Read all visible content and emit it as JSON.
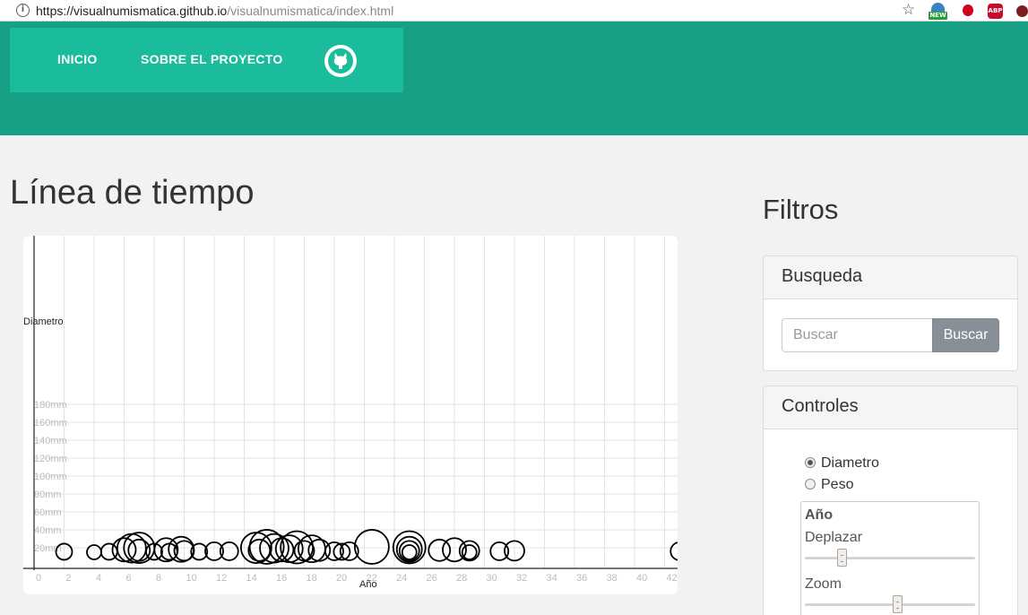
{
  "browser": {
    "url_host": "https://visualnumismatica.github.io",
    "url_path": "/visualnumismatica/index.html",
    "extensions": [
      "new-globe-icon",
      "bug-icon",
      "abp-icon",
      "extension-icon"
    ],
    "new_badge": "NEW",
    "abp_label": "ABP"
  },
  "nav": {
    "inicio": "INICIO",
    "sobre": "SOBRE EL PROYECTO"
  },
  "main": {
    "title": "Línea de tiempo"
  },
  "filters": {
    "title": "Filtros",
    "search": {
      "heading": "Busqueda",
      "placeholder": "Buscar",
      "button": "Buscar"
    },
    "controls": {
      "heading": "Controles",
      "options": [
        {
          "label": "Diametro",
          "checked": true
        },
        {
          "label": "Peso",
          "checked": false
        }
      ],
      "year": {
        "title": "Año",
        "pan_label": "Deplazar",
        "zoom_label": "Zoom",
        "pan_level": 0.2,
        "zoom_level": 0.55
      }
    }
  },
  "colors": {
    "header": "#18a085",
    "nav_box": "#1abc9c",
    "page_bg": "#f2f2f2",
    "button_gray": "#888f97"
  },
  "chart_data": {
    "type": "scatter",
    "xlabel": "Año",
    "ylabel": "Diametro",
    "x_ticks": [
      "0",
      "2",
      "4",
      "6",
      "8",
      "10",
      "12",
      "14",
      "16",
      "18",
      "20",
      "22",
      "24",
      "26",
      "28",
      "30",
      "32",
      "34",
      "36",
      "38",
      "40",
      "42"
    ],
    "y_ticks": [
      "20mm",
      "40mm",
      "60mm",
      "80mm",
      "100mm",
      "120mm",
      "140mm",
      "160mm",
      "180mm"
    ],
    "xlim": [
      0,
      43
    ],
    "ylim": [
      0,
      180
    ],
    "grid": true,
    "marker": "hollow-circle",
    "note_size": "circle size encodes diameter",
    "points": [
      {
        "x": 2,
        "d": 18
      },
      {
        "x": 4,
        "d": 16
      },
      {
        "x": 5,
        "d": 18
      },
      {
        "x": 6,
        "d": 26
      },
      {
        "x": 6.5,
        "d": 32
      },
      {
        "x": 7,
        "d": 34
      },
      {
        "x": 7,
        "d": 24
      },
      {
        "x": 8,
        "d": 18
      },
      {
        "x": 8.8,
        "d": 26
      },
      {
        "x": 9,
        "d": 18
      },
      {
        "x": 9.8,
        "d": 28
      },
      {
        "x": 10,
        "d": 22
      },
      {
        "x": 11,
        "d": 18
      },
      {
        "x": 12,
        "d": 20
      },
      {
        "x": 13,
        "d": 20
      },
      {
        "x": 14.8,
        "d": 34
      },
      {
        "x": 15,
        "d": 24
      },
      {
        "x": 15.5,
        "d": 38
      },
      {
        "x": 16,
        "d": 32
      },
      {
        "x": 16.5,
        "d": 26
      },
      {
        "x": 17,
        "d": 30
      },
      {
        "x": 17.5,
        "d": 36
      },
      {
        "x": 18,
        "d": 22
      },
      {
        "x": 18.5,
        "d": 30
      },
      {
        "x": 19,
        "d": 24
      },
      {
        "x": 20,
        "d": 20
      },
      {
        "x": 20.5,
        "d": 18
      },
      {
        "x": 21,
        "d": 20
      },
      {
        "x": 22.5,
        "d": 38
      },
      {
        "x": 25,
        "d": 36
      },
      {
        "x": 25,
        "d": 28
      },
      {
        "x": 25,
        "d": 22
      },
      {
        "x": 25,
        "d": 16
      },
      {
        "x": 27,
        "d": 24
      },
      {
        "x": 28,
        "d": 26
      },
      {
        "x": 29,
        "d": 22
      },
      {
        "x": 29,
        "d": 16
      },
      {
        "x": 31,
        "d": 20
      },
      {
        "x": 32,
        "d": 22
      },
      {
        "x": 43,
        "d": 20
      }
    ]
  }
}
